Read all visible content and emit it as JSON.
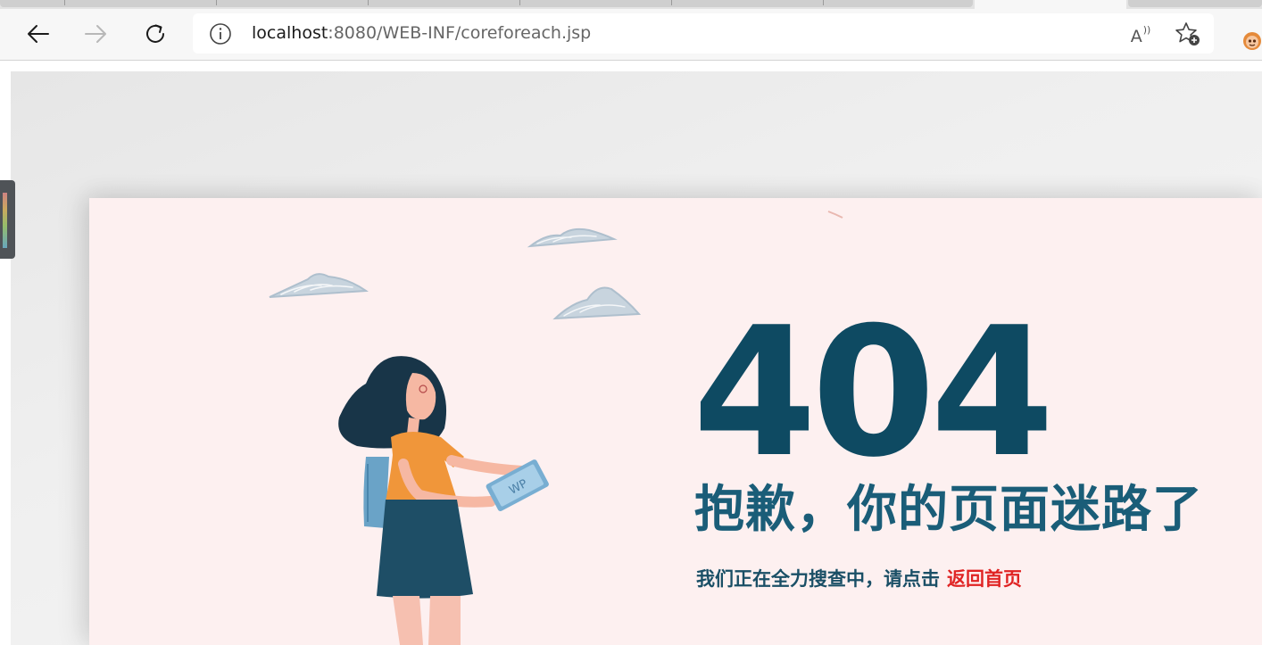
{
  "browser": {
    "url_host": "localhost",
    "url_rest": ":8080/WEB-INF/coreforeach.jsp",
    "read_aloud_label": "A",
    "read_aloud_sub": "))"
  },
  "page": {
    "error_code": "404",
    "headline": "抱歉，你的页面迷路了",
    "subline": "我们正在全力搜查中，请点击",
    "home_link": "返回首页",
    "tablet_text": "WP"
  },
  "colors": {
    "accent_dark": "#0e4a62",
    "headline": "#1a5d78",
    "link": "#e02424",
    "card_bg": "#fdf0f0"
  }
}
